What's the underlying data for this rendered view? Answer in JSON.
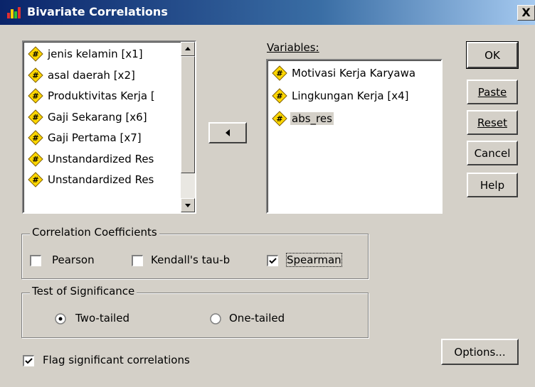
{
  "window": {
    "title": "Bivariate Correlations",
    "close_label": "X"
  },
  "source_list": {
    "items": [
      "jenis kelamin [x1]",
      "asal daerah [x2]",
      "Produktivitas Kerja [",
      "Gaji Sekarang [x6]",
      "Gaji Pertama [x7]",
      "Unstandardized Res",
      "Unstandardized Res"
    ]
  },
  "variables": {
    "label": "Variables:",
    "items": [
      "Motivasi Kerja Karyawa",
      "Lingkungan Kerja [x4]",
      "abs_res"
    ],
    "selected_index": 2
  },
  "buttons": {
    "ok": "OK",
    "paste": "Paste",
    "reset": "Reset",
    "cancel": "Cancel",
    "help": "Help",
    "options": "Options..."
  },
  "correlation_coefficients": {
    "label": "Correlation Coefficients",
    "pearson": {
      "label": "Pearson",
      "checked": false
    },
    "kendall": {
      "label": "Kendall's tau-b",
      "checked": false
    },
    "spearman": {
      "label": "Spearman",
      "checked": true
    }
  },
  "test_of_significance": {
    "label": "Test of Significance",
    "two_tailed": {
      "label": "Two-tailed",
      "selected": true
    },
    "one_tailed": {
      "label": "One-tailed",
      "selected": false
    }
  },
  "flag_significant": {
    "label": "Flag significant correlations",
    "checked": true
  },
  "colors": {
    "title_bar": "#0a246a",
    "face": "#d4d0c8",
    "variable_icon": "#ffd700"
  }
}
